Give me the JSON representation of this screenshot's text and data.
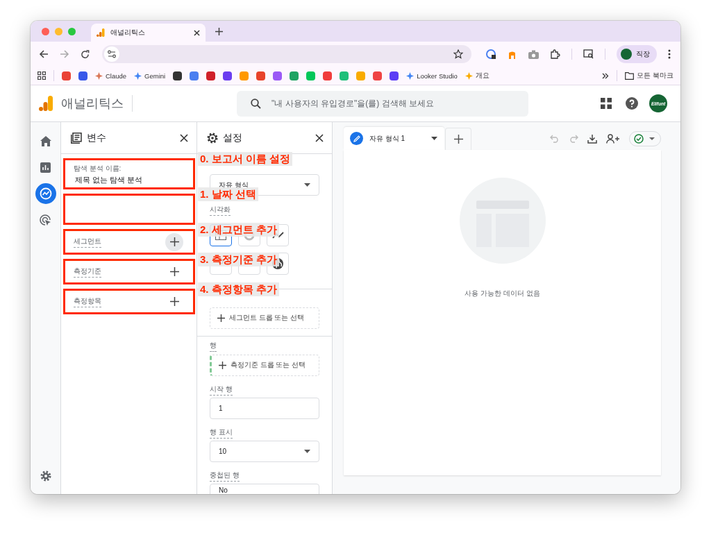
{
  "browser": {
    "tab": {
      "title": "애널리틱스"
    },
    "bookmarks": [
      {
        "kind": "icon",
        "color": "#ea4335"
      },
      {
        "kind": "icon",
        "color": "#3858e9"
      },
      {
        "kind": "link",
        "label": "Claude",
        "color": "#d97757"
      },
      {
        "kind": "link",
        "label": "Gemini",
        "color": "#4285f4"
      },
      {
        "kind": "icon",
        "color": "#333333"
      },
      {
        "kind": "icon",
        "color": "#4a7ff0"
      },
      {
        "kind": "icon",
        "color": "#d0202a"
      },
      {
        "kind": "icon",
        "color": "#6a3df0"
      },
      {
        "kind": "icon",
        "color": "#ff9900"
      },
      {
        "kind": "icon",
        "color": "#e8432b"
      },
      {
        "kind": "icon",
        "color": "#9b59f6"
      },
      {
        "kind": "icon",
        "color": "#1ea362"
      },
      {
        "kind": "icon",
        "color": "#03c75a"
      },
      {
        "kind": "icon",
        "color": "#f03c3c"
      },
      {
        "kind": "icon",
        "color": "#1fbf7a"
      },
      {
        "kind": "icon",
        "color": "#f9ab00"
      },
      {
        "kind": "icon",
        "color": "#ef4444"
      },
      {
        "kind": "icon",
        "color": "#5b3df5"
      },
      {
        "kind": "link",
        "label": "Looker Studio",
        "color": "#4285f4"
      },
      {
        "kind": "link",
        "label": "개요",
        "color": "#f9ab00"
      }
    ],
    "all_bookmarks": "모든 북마크",
    "profile": {
      "label": "직장"
    }
  },
  "app": {
    "title": "애널리틱스",
    "search": {
      "placeholder": "\"내 사용자의 유입경로\"을(를) 검색해 보세요"
    },
    "avatar": "Elifunt"
  },
  "rail": [
    {
      "kind": "home",
      "selected": false
    },
    {
      "kind": "reports",
      "selected": false
    },
    {
      "kind": "explore",
      "selected": true
    },
    {
      "kind": "advertising",
      "selected": false
    }
  ],
  "variables": {
    "title": "변수",
    "sections": [
      {
        "kind": "name",
        "label": "탐색 분석 이름:",
        "value": "제목 없는 탐색 분석"
      },
      {
        "kind": "empty"
      },
      {
        "kind": "add",
        "label": "세그먼트",
        "hovered": true
      },
      {
        "kind": "add",
        "label": "측정기준",
        "hovered": false
      },
      {
        "kind": "add",
        "label": "측정항목",
        "hovered": false
      }
    ]
  },
  "settings": {
    "title": "설정",
    "technique": "자유 형식",
    "visualization_label": "시각화",
    "visualizations": [
      {
        "kind": "table",
        "selected": true
      },
      {
        "kind": "donut",
        "selected": false
      },
      {
        "kind": "line",
        "selected": false
      },
      {
        "kind": "scatter",
        "selected": false
      },
      {
        "kind": "bar",
        "selected": false
      },
      {
        "kind": "geo",
        "selected": false
      }
    ],
    "segment_drop": "세그먼트 드롭 또는 선택",
    "rows_label": "행",
    "rows_drop": "측정기준 드롭 또는 선택",
    "start_row_label": "시작 행",
    "start_row": "1",
    "show_rows_label": "행 표시",
    "show_rows": "10",
    "nested_rows_label": "중첩된 행",
    "nested_rows": "No"
  },
  "annotations": [
    {
      "label": "0. 보고서 이름 설정"
    },
    {
      "label": "1. 날짜 선택"
    },
    {
      "label": "2. 세그먼트 추가"
    },
    {
      "label": "3. 측정기준 추가"
    },
    {
      "label": "4. 측정항목 추가"
    }
  ],
  "canvas": {
    "tab": {
      "label": "자유 형식 1"
    },
    "undo_disabled": true,
    "redo_disabled": true,
    "empty_message": "사용 가능한 데이터 없음"
  }
}
